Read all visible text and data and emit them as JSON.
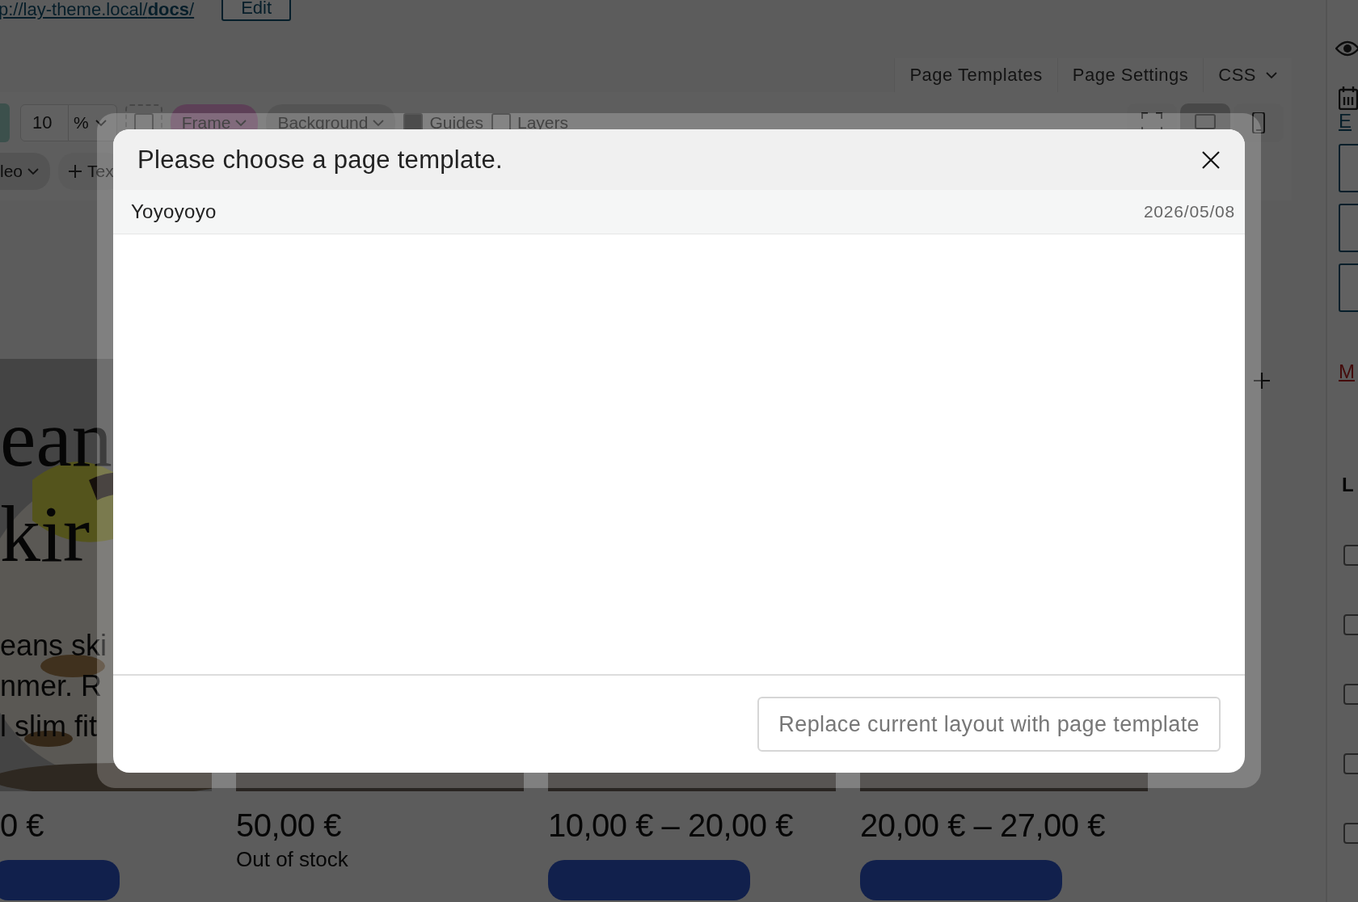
{
  "address_bar": {
    "link": "p://lay-theme.local/**docs**/",
    "button": "Edit"
  },
  "tabs": [
    {
      "label": "Page Templates",
      "has_menu": false
    },
    {
      "label": "Page Settings",
      "has_menu": false
    },
    {
      "label": "CSS",
      "has_menu": true
    }
  ],
  "toolbar": {
    "row_1": [
      {
        "kind": "number",
        "value": "10"
      },
      {
        "kind": "unit",
        "label": "%"
      },
      {
        "kind": "box-toggle",
        "checked": false
      },
      {
        "kind": "dropdown",
        "label": "Frame",
        "highlighted": true
      },
      {
        "kind": "dropdown",
        "label": "Background",
        "highlighted": false
      },
      {
        "kind": "checkbox",
        "label": "Guides",
        "checked": true
      },
      {
        "kind": "checkbox",
        "label": "Layers",
        "checked": false
      }
    ],
    "views": [
      {
        "kind": "fullscreen",
        "selected": false
      },
      {
        "kind": "desktop",
        "selected": true
      },
      {
        "kind": "phone",
        "selected": false
      }
    ],
    "row_2": [
      {
        "kind": "dropdown",
        "label": "leo"
      },
      {
        "kind": "add",
        "label": "Tex"
      }
    ]
  },
  "canvas": {
    "heading_lines": [
      "ean",
      "kir"
    ],
    "text_lines": [
      "eans ski",
      "nmer. R",
      "l slim fit"
    ],
    "products": [
      {
        "price": "0 €"
      },
      {
        "price": "50,00 €",
        "stock": "Out of stock"
      },
      {
        "price": "10,00 € – 20,00 €"
      },
      {
        "price": "20,00 € – 27,00 €"
      }
    ]
  },
  "sidebar": {
    "link": "E",
    "remove_link": "M",
    "panel_title": "L",
    "checkboxes": [
      {
        "checked": false
      },
      {
        "checked": false
      },
      {
        "checked": false
      },
      {
        "checked": false
      },
      {
        "checked": false
      }
    ]
  },
  "modal": {
    "title": "Please choose a page template.",
    "templates": [
      {
        "name": "Yoyoyoyo",
        "date": "2026/05/08"
      }
    ],
    "button": "Replace current layout with page template"
  }
}
